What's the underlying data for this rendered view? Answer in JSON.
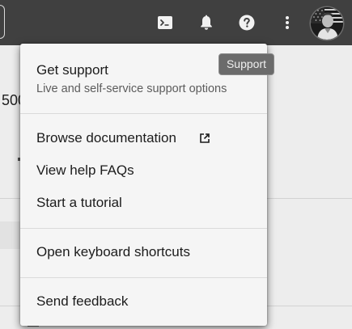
{
  "header": {
    "icons": [
      "terminal-icon",
      "bell-icon",
      "help-icon",
      "more-vertical-icon",
      "avatar"
    ]
  },
  "background": {
    "partial_value": "500"
  },
  "menu": {
    "sections": [
      {
        "items": [
          {
            "label": "Get support",
            "sublabel": "Live and self-service support options"
          }
        ]
      },
      {
        "items": [
          {
            "label": "Browse documentation",
            "icon": "external-link-icon"
          },
          {
            "label": "View help FAQs"
          },
          {
            "label": "Start a tutorial"
          }
        ]
      },
      {
        "items": [
          {
            "label": "Open keyboard shortcuts"
          }
        ]
      },
      {
        "items": [
          {
            "label": "Send feedback"
          }
        ]
      }
    ]
  },
  "tooltip": {
    "text": "Support"
  }
}
